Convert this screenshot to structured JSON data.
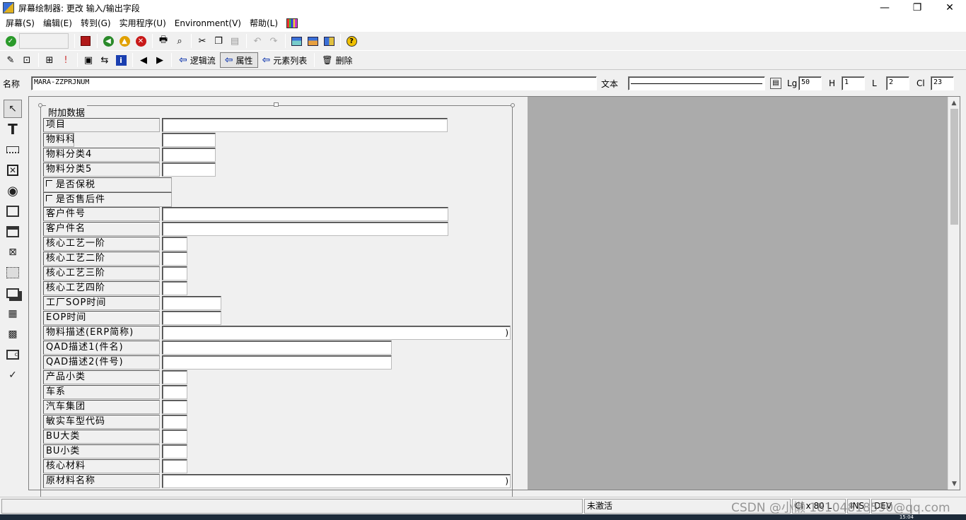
{
  "window": {
    "title": "屏幕绘制器:  更改 输入/输出字段",
    "minimize": "—",
    "maximize": "❐",
    "close": "✕"
  },
  "menu": [
    "屏幕(S)",
    "编辑(E)",
    "转到(G)",
    "实用程序(U)",
    "Environment(V)",
    "帮助(L)"
  ],
  "toolbar2": {
    "logic_flow": "逻辑流",
    "attributes": "属性",
    "element_list": "元素列表",
    "delete": "删除"
  },
  "attr_bar": {
    "name_label": "名称",
    "name_value": "MARA-ZZPRJNUM",
    "text_label": "文本",
    "text_value": "",
    "lg_label": "Lg",
    "lg_value": "50",
    "h_label": "H",
    "h_value": "1",
    "l_label": "L",
    "l_value": "2",
    "cl_label": "Cl",
    "cl_value": "23"
  },
  "frame": {
    "title": "附加数据",
    "rows": [
      {
        "label": "项目"
      },
      {
        "label": "物料科"
      },
      {
        "label": "物料分类4"
      },
      {
        "label": "物料分类5"
      },
      {
        "label": "是否保税"
      },
      {
        "label": "是否售后件"
      },
      {
        "label": "客户件号"
      },
      {
        "label": "客户件名"
      },
      {
        "label": "核心工艺一阶"
      },
      {
        "label": "核心工艺二阶"
      },
      {
        "label": "核心工艺三阶"
      },
      {
        "label": "核心工艺四阶"
      },
      {
        "label": "工厂SOP时间"
      },
      {
        "label": "EOP时间"
      },
      {
        "label": "物料描述(ERP简称)"
      },
      {
        "label": "QAD描述1(件名)"
      },
      {
        "label": "QAD描述2(件号)"
      },
      {
        "label": "产品小类"
      },
      {
        "label": "车系"
      },
      {
        "label": "汽车集团"
      },
      {
        "label": "敏实车型代码"
      },
      {
        "label": "BU大类"
      },
      {
        "label": "BU小类"
      },
      {
        "label": "核心材料"
      },
      {
        "label": "原材料名称"
      }
    ]
  },
  "status": {
    "state": "未激活",
    "cl_info": "Cl x 80 L",
    "mode": "INS",
    "system": "DEV"
  },
  "watermark": "CSDN @小懒 18104818590@qq.com",
  "clock": "15:04"
}
